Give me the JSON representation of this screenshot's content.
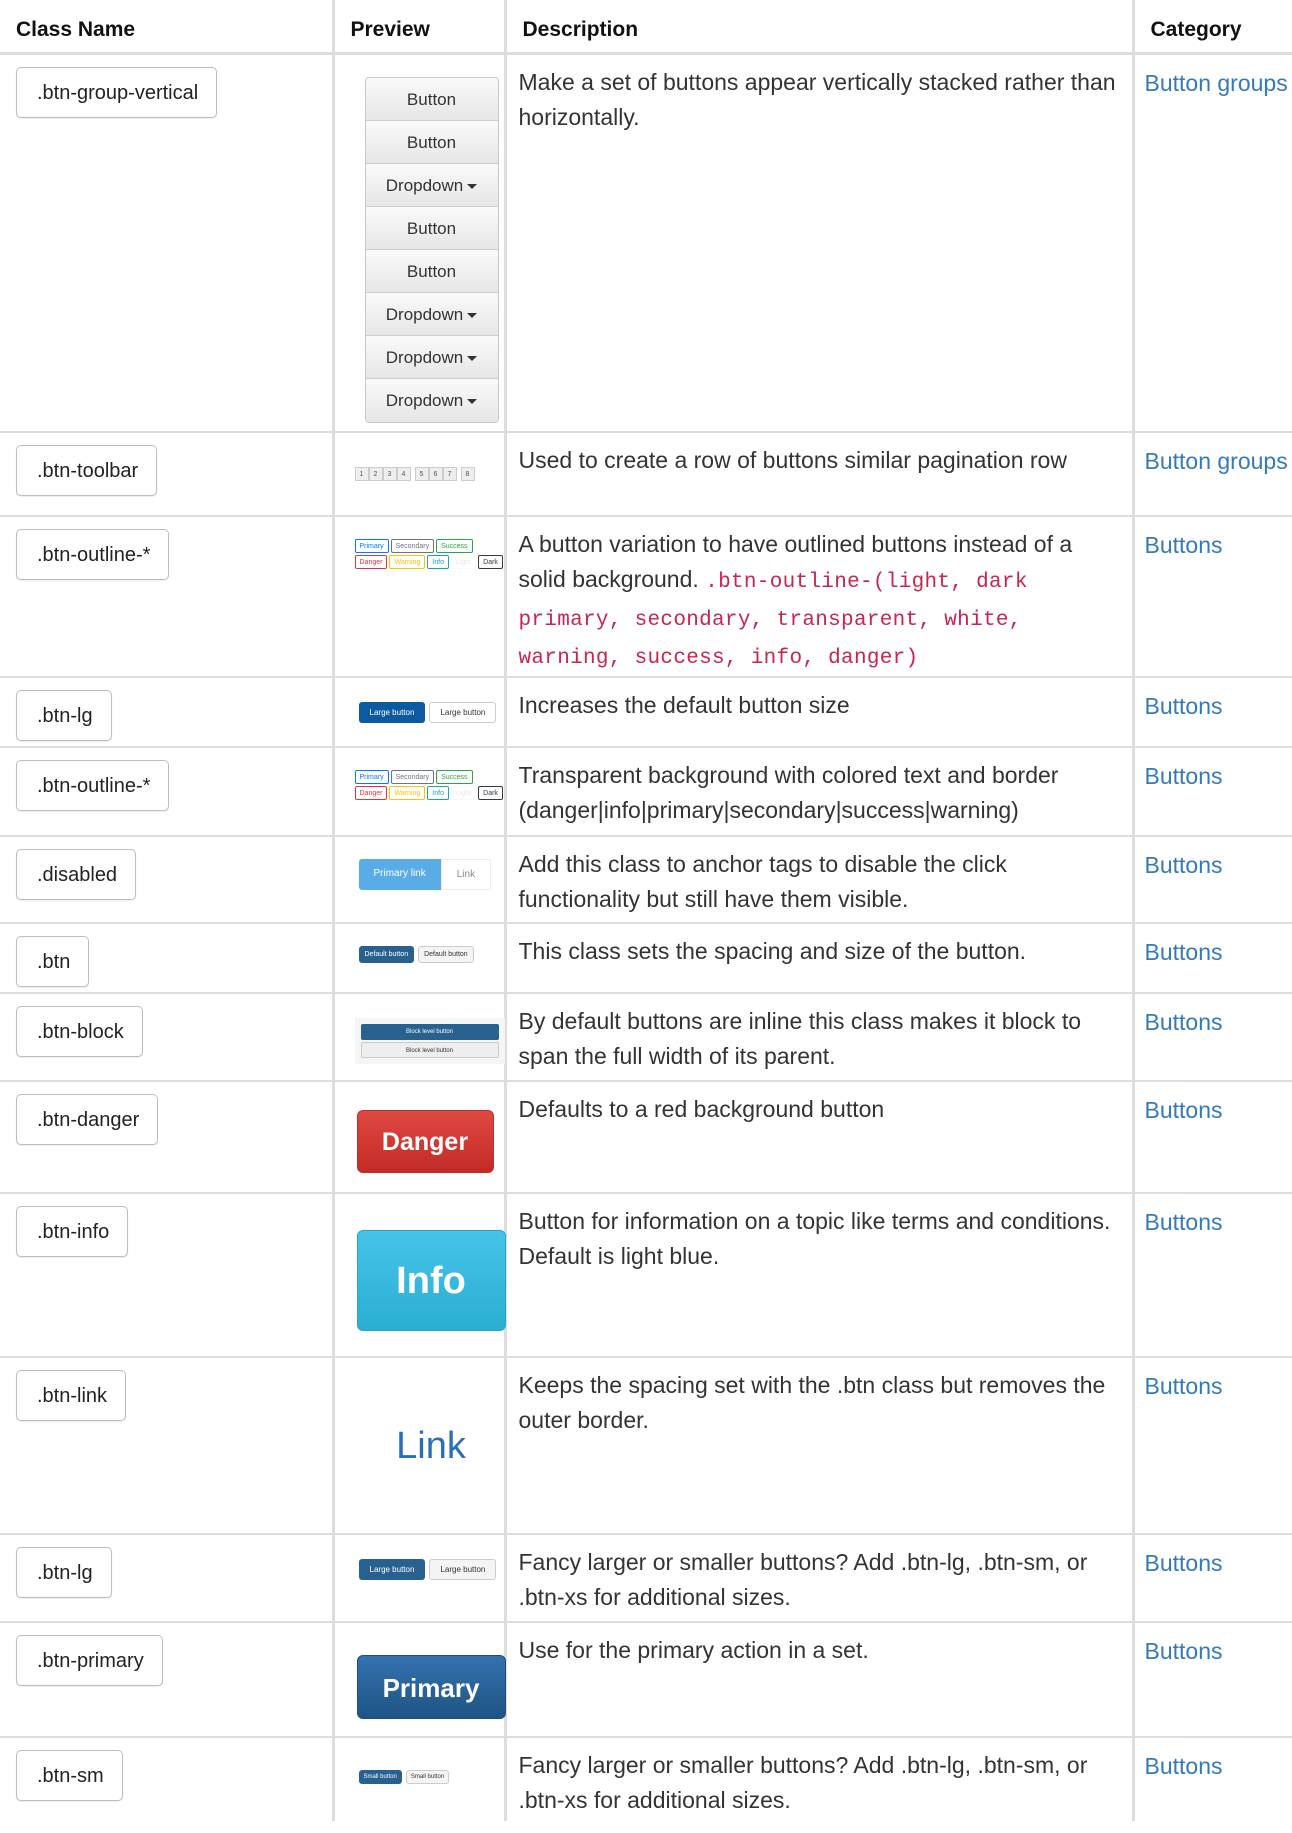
{
  "headers": {
    "class_name": "Class Name",
    "preview": "Preview",
    "description": "Description",
    "category": "Category"
  },
  "colors": {
    "link": "#337ab7",
    "code": "#c7254e",
    "primary": "#286090",
    "danger": "#d9534f",
    "info": "#5bc0de"
  },
  "rows": [
    {
      "name": ".btn-group-vertical",
      "desc": "Make a set of buttons appear vertically stacked rather than horizontally.",
      "cat": "Button groups",
      "preview": {
        "items": [
          "Button",
          "Button",
          "Dropdown",
          "Button",
          "Button",
          "Dropdown",
          "Dropdown",
          "Dropdown"
        ]
      }
    },
    {
      "name": ".btn-toolbar",
      "desc": "Used to create a row of buttons similar pagination row",
      "cat": "Button groups",
      "preview": {
        "items": [
          "1",
          "2",
          "3",
          "4",
          "5",
          "6",
          "7",
          "8"
        ]
      }
    },
    {
      "name": ".btn-outline-*",
      "desc": "A button variation to have outlined buttons instead of a solid background. ",
      "code": ".btn-outline-(light, dark primary, secondary, transparent, white, warning, success, info, danger)",
      "cat": "Buttons",
      "preview": {
        "items": [
          "Primary",
          "Secondary",
          "Success",
          "Danger",
          "Warning",
          "Info",
          "Light",
          "Dark"
        ]
      }
    },
    {
      "name": ".btn-lg",
      "desc": "Increases the default button size",
      "cat": "Buttons",
      "preview": {
        "items": [
          "Large button",
          "Large button"
        ]
      }
    },
    {
      "name": ".btn-outline-*",
      "desc": "Transparent background with colored text and border (danger|info|primary|secondary|success|warning)",
      "cat": "Buttons",
      "preview": {
        "items": [
          "Primary",
          "Secondary",
          "Success",
          "Danger",
          "Warning",
          "Info",
          "Light",
          "Dark"
        ]
      }
    },
    {
      "name": ".disabled",
      "desc": "Add this class to anchor tags to disable the click functionality but still have them visible.",
      "cat": "Buttons",
      "preview": {
        "items": [
          "Primary link",
          "Link"
        ]
      }
    },
    {
      "name": ".btn",
      "desc": "This class sets the spacing and size of the button.",
      "cat": "Buttons",
      "preview": {
        "items": [
          "Default button",
          "Default button"
        ]
      }
    },
    {
      "name": ".btn-block",
      "desc": "By default buttons are inline this class makes it block to span the full width of its parent.",
      "cat": "Buttons",
      "preview": {
        "items": [
          "Block level button",
          "Block level button"
        ]
      }
    },
    {
      "name": ".btn-danger",
      "desc": "Defaults to a red background button",
      "cat": "Buttons",
      "preview": {
        "items": [
          "Danger"
        ]
      }
    },
    {
      "name": ".btn-info",
      "desc": "Button for information on a topic like terms and conditions. Default is light blue.",
      "cat": "Buttons",
      "preview": {
        "items": [
          "Info"
        ]
      }
    },
    {
      "name": ".btn-link",
      "desc": "Keeps the spacing set with the .btn class but removes the outer border.",
      "cat": "Buttons",
      "preview": {
        "items": [
          "Link"
        ]
      }
    },
    {
      "name": ".btn-lg",
      "desc": "Fancy larger or smaller buttons? Add .btn-lg, .btn-sm, or .btn-xs for additional sizes.",
      "cat": "Buttons",
      "preview": {
        "items": [
          "Large button",
          "Large button"
        ]
      }
    },
    {
      "name": ".btn-primary",
      "desc": "Use for the primary action in a set.",
      "cat": "Buttons",
      "preview": {
        "items": [
          "Primary"
        ]
      }
    },
    {
      "name": ".btn-sm",
      "desc": "Fancy larger or smaller buttons? Add .btn-lg, .btn-sm, or .btn-xs for additional sizes.",
      "cat": "Buttons",
      "preview": {
        "items": [
          "Small button",
          "Small button"
        ]
      }
    }
  ]
}
